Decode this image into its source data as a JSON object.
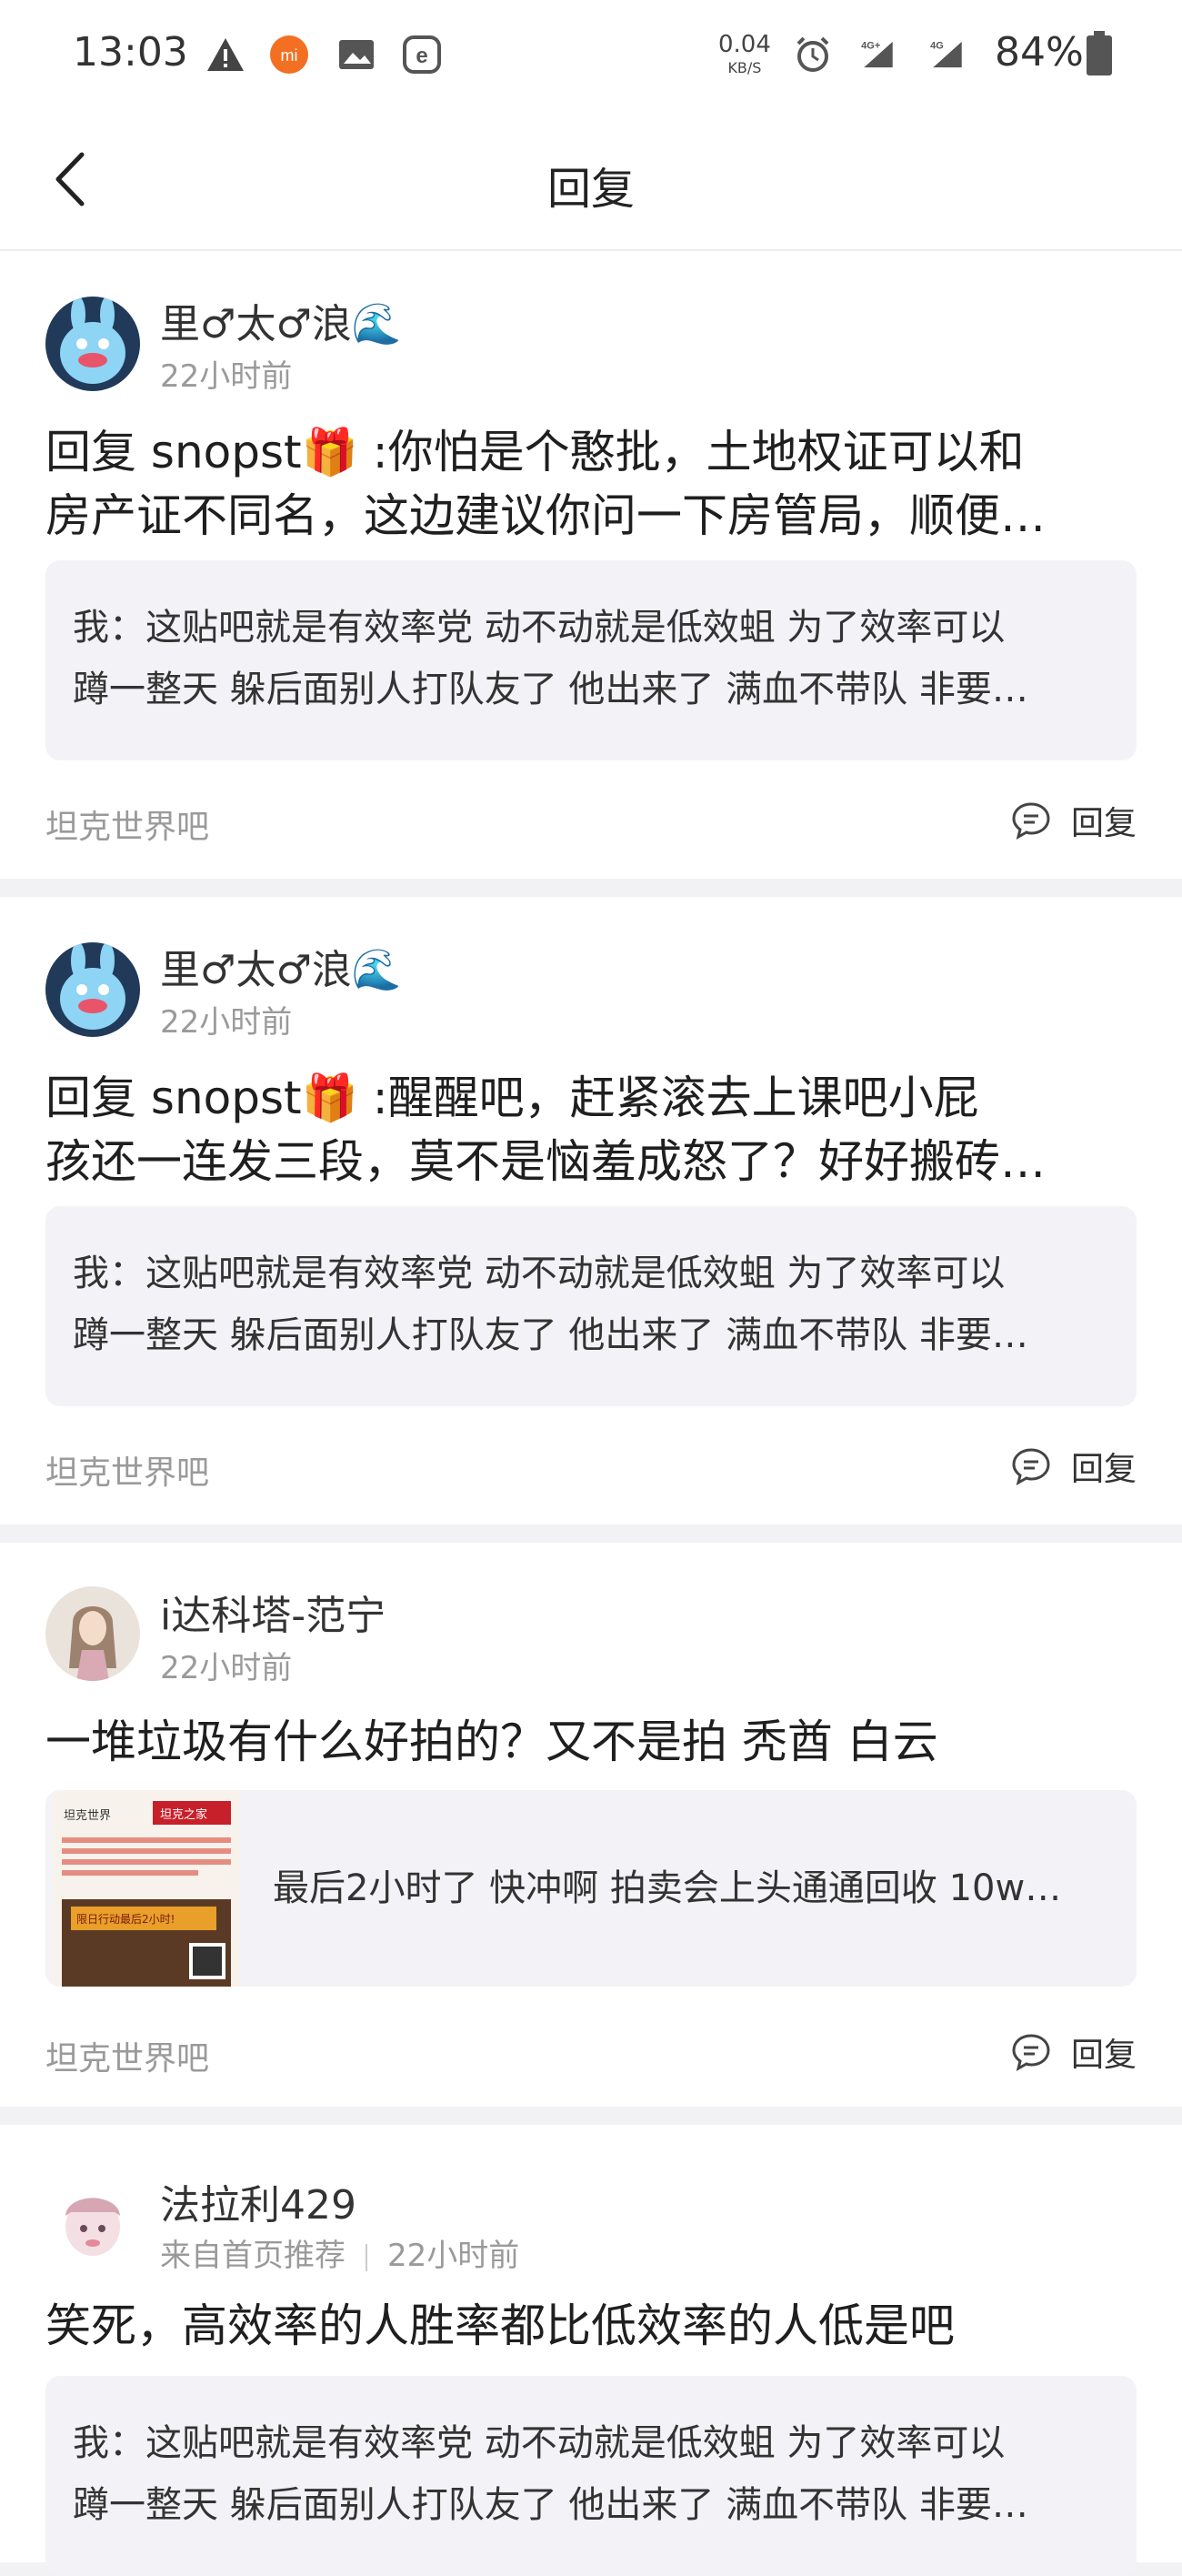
{
  "status_bar": {
    "time": "13:03",
    "net_speed": "0.04",
    "net_speed_unit": "KB/S",
    "signal_1": "4G+",
    "signal_2": "4G",
    "battery": "84%"
  },
  "header": {
    "title": "回复",
    "back_icon": "chevron-left-icon"
  },
  "reply_action_label": "回复",
  "reply_icon": "comment-icon",
  "posts": [
    {
      "username": "里♂太♂浪🌊",
      "time": "22小时前",
      "reply_lines": [
        "回复  snopst🎁 :你怕是个憨批，土地权证可以和",
        "房产证不同名，这边建议你问一下房管局，顺便…"
      ],
      "quote_lines": [
        "我：这贴吧就是有效率党 动不动就是低效蛆 为了效率可以",
        "蹲一整天 躲后面别人打队友了 他出来了 满血不带队 非要…"
      ],
      "forum": "坦克世界吧"
    },
    {
      "username": "里♂太♂浪🌊",
      "time": "22小时前",
      "reply_lines": [
        "回复  snopst🎁 :醒醒吧，赶紧滚去上课吧小屁",
        "孩还一连发三段，莫不是恼羞成怒了？好好搬砖…"
      ],
      "quote_lines": [
        "我：这贴吧就是有效率党 动不动就是低效蛆 为了效率可以",
        "蹲一整天 躲后面别人打队友了 他出来了 满血不带队 非要…"
      ],
      "forum": "坦克世界吧"
    },
    {
      "username": "i达科塔-范宁",
      "time": "22小时前",
      "reply_lines": [
        "一堆垃圾有什么好拍的？又不是拍 秃酋 白云"
      ],
      "quote_lines": [
        "最后2小时了 快冲啊 拍卖会上头通通回收 10w…"
      ],
      "thumb_title_1": "坦克世界",
      "thumb_title_2": "坦克之家",
      "thumb_banner": "限日行动最后2小时!",
      "forum": "坦克世界吧"
    },
    {
      "username": "法拉利429",
      "source": "来自首页推荐",
      "time": "22小时前",
      "reply_lines": [
        "笑死，高效率的人胜率都比低效率的人低是吧"
      ],
      "quote_lines": [
        "我：这贴吧就是有效率党 动不动就是低效蛆 为了效率可以",
        "蹲一整天 躲后面别人打队友了 他出来了 满血不带队 非要…"
      ]
    }
  ]
}
